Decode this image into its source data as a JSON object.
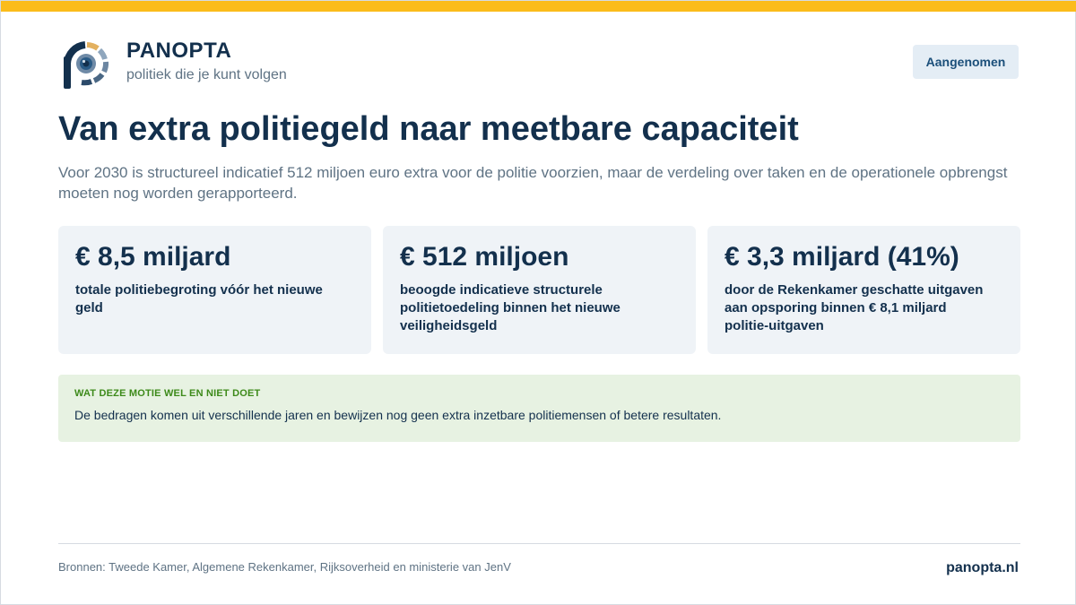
{
  "brand": {
    "name": "PANOPTA",
    "tagline": "politiek die je kunt volgen"
  },
  "status": {
    "label": "Aangenomen"
  },
  "article": {
    "title": "Van extra politiegeld naar meetbare capaciteit",
    "lead": "Voor 2030 is structureel indicatief 512 miljoen euro extra voor de politie voorzien, maar de verdeling over taken en de operationele opbrengst moeten nog worden gerapporteerd."
  },
  "stats": [
    {
      "value": "€ 8,5 miljard",
      "label": "totale politiebegroting vóór het nieuwe geld"
    },
    {
      "value": "€ 512 miljoen",
      "label": "beoogde indicatieve structurele politietoedeling binnen het nieuwe veiligheidsgeld"
    },
    {
      "value": "€ 3,3 miljard (41%)",
      "label": "door de Rekenkamer geschatte uitgaven aan opsporing binnen € 8,1 miljard politie-uitgaven"
    }
  ],
  "note": {
    "heading": "WAT DEZE MOTIE WEL EN NIET DOET",
    "body": "De bedragen komen uit verschillende jaren en bewijzen nog geen extra inzetbare politiemensen of betere resultaten."
  },
  "footer": {
    "sources": "Bronnen: Tweede Kamer, Algemene Rekenkamer, Rijksoverheid en ministerie van JenV",
    "site": "panopta.nl"
  },
  "colors": {
    "accent_bar": "#fbbc1b",
    "navy": "#13304d",
    "muted": "#5f7384",
    "card_bg": "#eff3f7",
    "note_bg": "#e7f2e2",
    "note_heading": "#3d8a1a"
  },
  "icons": {
    "logo": "eye-logo-icon"
  }
}
